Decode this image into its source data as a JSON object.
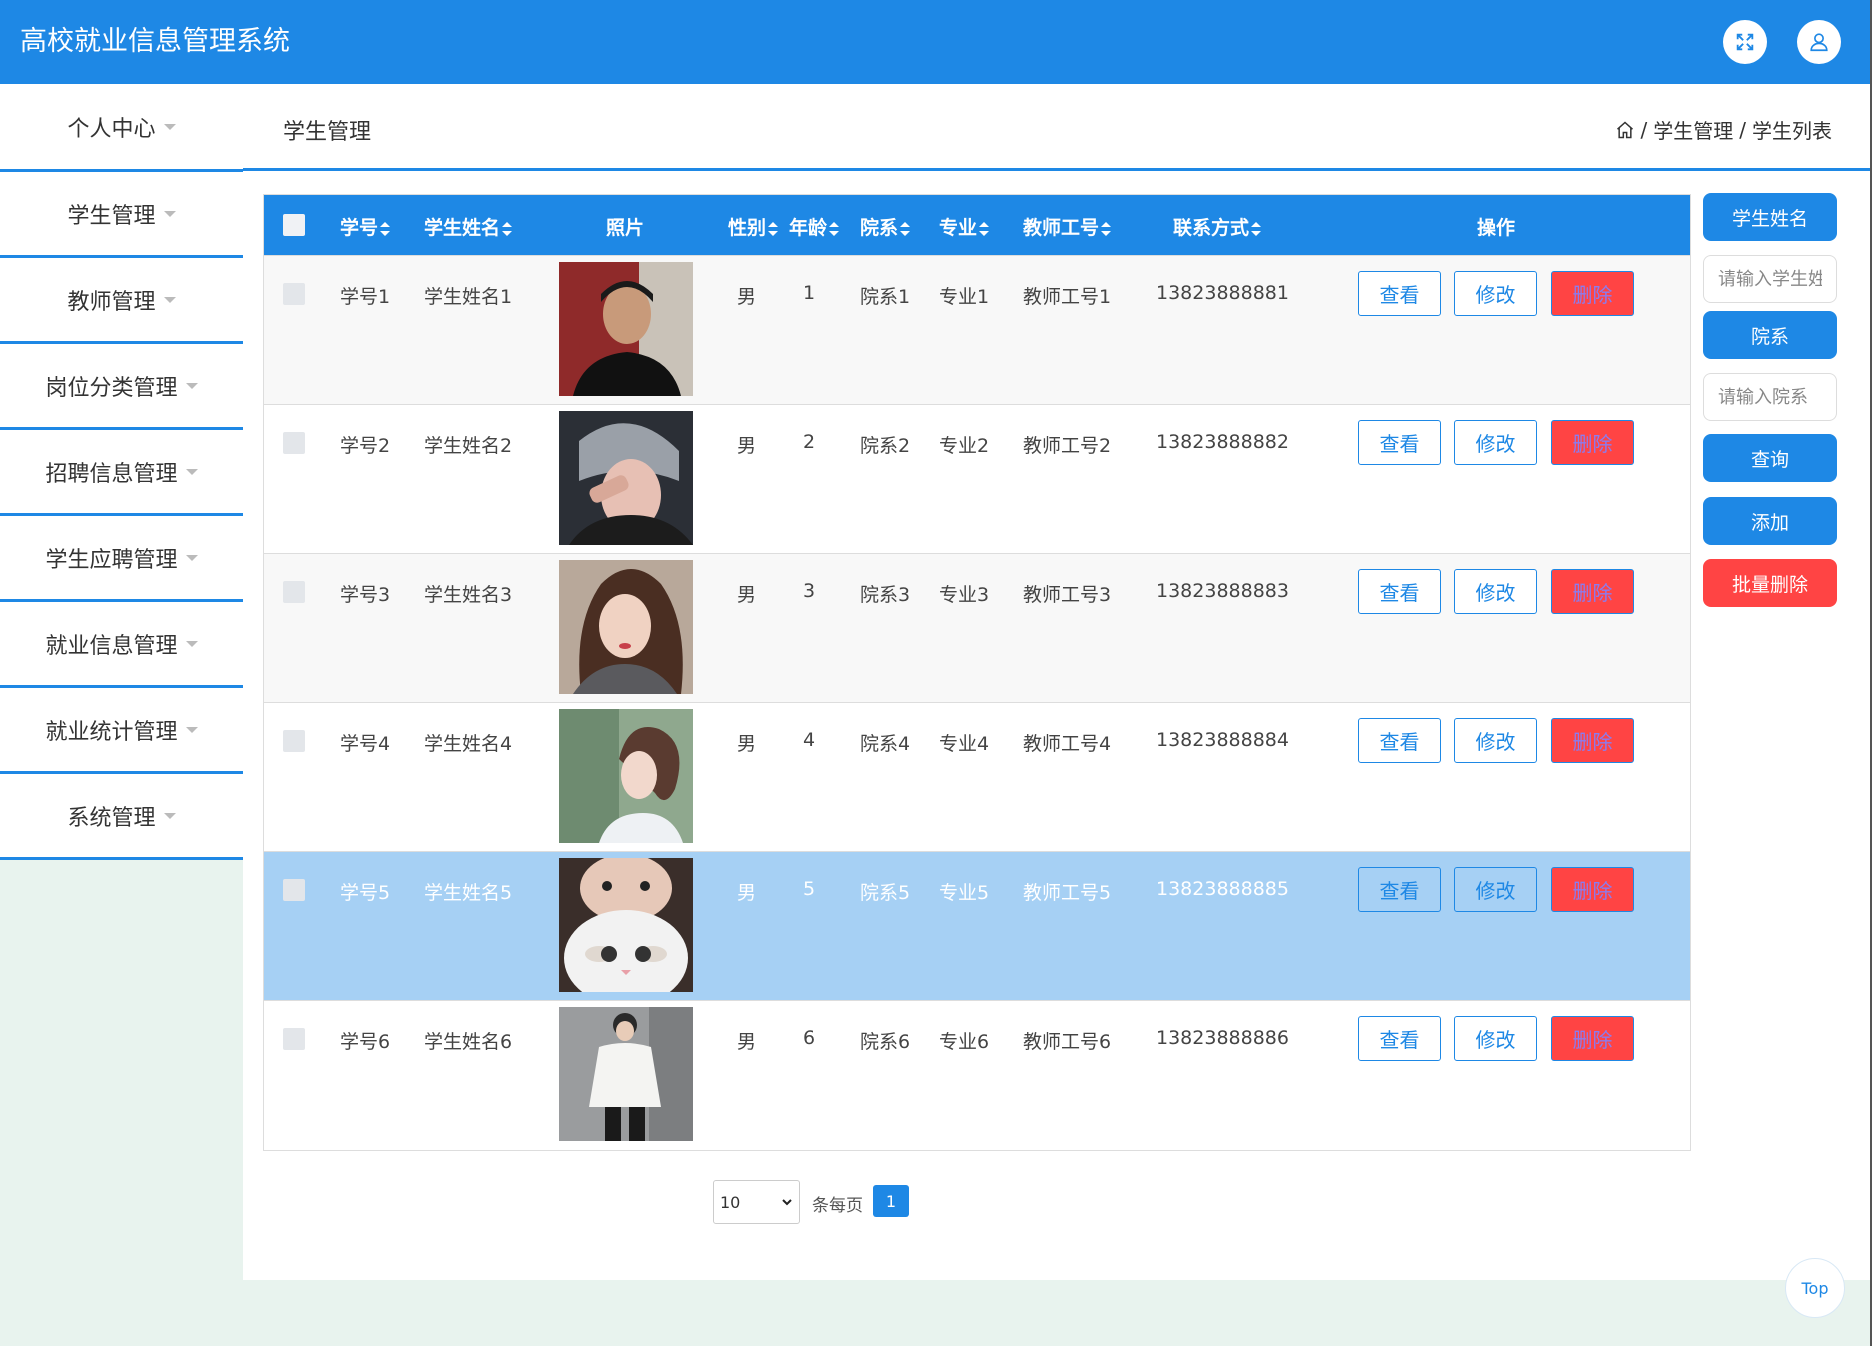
{
  "app": {
    "title": "高校就业信息管理系统"
  },
  "header": {
    "fullscreen_icon": "expand-icon",
    "user_icon": "user-icon"
  },
  "sidebar": {
    "items": [
      {
        "label": "个人中心"
      },
      {
        "label": "学生管理"
      },
      {
        "label": "教师管理"
      },
      {
        "label": "岗位分类管理"
      },
      {
        "label": "招聘信息管理"
      },
      {
        "label": "学生应聘管理"
      },
      {
        "label": "就业信息管理"
      },
      {
        "label": "就业统计管理"
      },
      {
        "label": "系统管理"
      }
    ]
  },
  "page": {
    "title": "学生管理",
    "breadcrumb": {
      "sep": "/",
      "level1": "学生管理",
      "level2": "学生列表"
    }
  },
  "table": {
    "headers": {
      "id": "学号",
      "name": "学生姓名",
      "photo": "照片",
      "gender": "性别",
      "age": "年龄",
      "dept": "院系",
      "major": "专业",
      "teacher": "教师工号",
      "phone": "联系方式",
      "actions": "操作"
    },
    "actions": {
      "view": "查看",
      "edit": "修改",
      "delete": "删除"
    },
    "rows": [
      {
        "id": "学号1",
        "name": "学生姓名1",
        "gender": "男",
        "age": "1",
        "dept": "院系1",
        "major": "专业1",
        "teacher": "教师工号1",
        "phone": "13823888881"
      },
      {
        "id": "学号2",
        "name": "学生姓名2",
        "gender": "男",
        "age": "2",
        "dept": "院系2",
        "major": "专业2",
        "teacher": "教师工号2",
        "phone": "13823888882"
      },
      {
        "id": "学号3",
        "name": "学生姓名3",
        "gender": "男",
        "age": "3",
        "dept": "院系3",
        "major": "专业3",
        "teacher": "教师工号3",
        "phone": "13823888883"
      },
      {
        "id": "学号4",
        "name": "学生姓名4",
        "gender": "男",
        "age": "4",
        "dept": "院系4",
        "major": "专业4",
        "teacher": "教师工号4",
        "phone": "13823888884"
      },
      {
        "id": "学号5",
        "name": "学生姓名5",
        "gender": "男",
        "age": "5",
        "dept": "院系5",
        "major": "专业5",
        "teacher": "教师工号5",
        "phone": "13823888885"
      },
      {
        "id": "学号6",
        "name": "学生姓名6",
        "gender": "男",
        "age": "6",
        "dept": "院系6",
        "major": "专业6",
        "teacher": "教师工号6",
        "phone": "13823888886"
      }
    ]
  },
  "search": {
    "name_label": "学生姓名",
    "name_placeholder": "请输入学生姓名",
    "dept_label": "院系",
    "dept_placeholder": "请输入院系",
    "query_label": "查询",
    "add_label": "添加",
    "batch_delete_label": "批量删除"
  },
  "pagination": {
    "page_size": "10",
    "per_page_label": "条每页",
    "current_page": "1"
  },
  "back_to_top": "Top",
  "colors": {
    "primary": "#1e88e5",
    "danger": "#ff4444",
    "selected_row": "#a6d0f4",
    "background": "#e8f3ee"
  }
}
